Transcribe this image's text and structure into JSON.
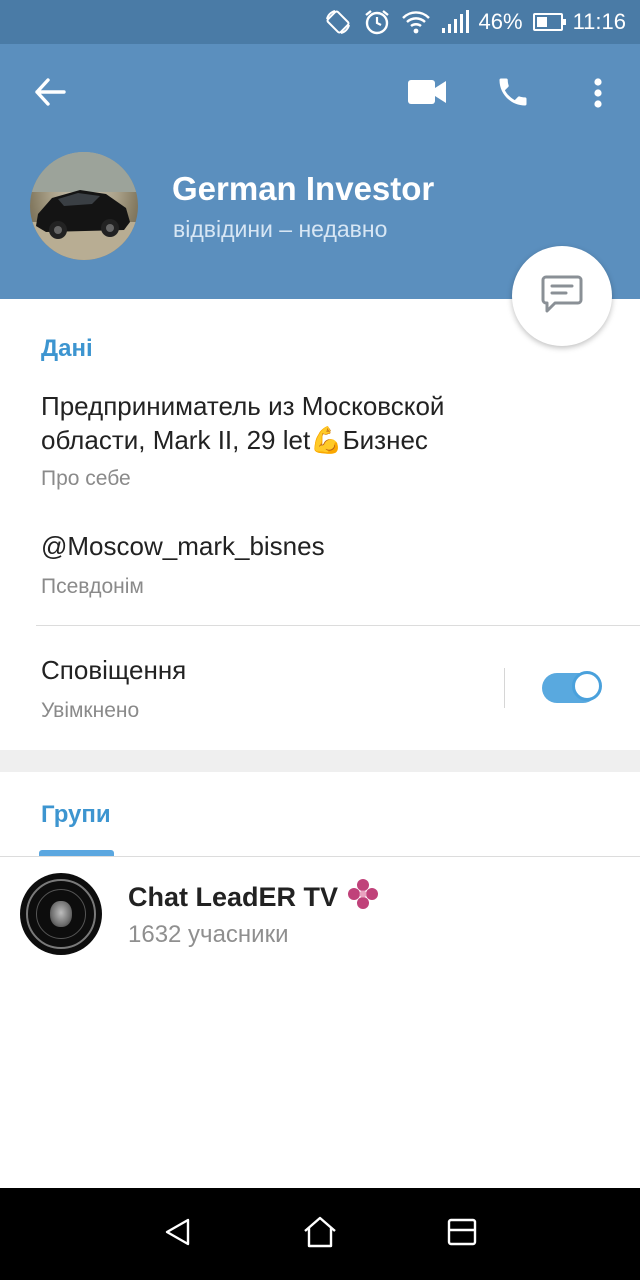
{
  "status_bar": {
    "battery_percent": "46%",
    "battery_level": 0.46,
    "time": "11:16",
    "icons": [
      "rotate-icon",
      "alarm-icon",
      "wifi-icon",
      "signal-icon",
      "battery-icon"
    ]
  },
  "header": {
    "icons": [
      "back-arrow-icon",
      "video-call-icon",
      "phone-icon",
      "more-vert-icon"
    ],
    "profile": {
      "name": "German Investor",
      "status": "відвідини – недавно"
    },
    "fab_icon": "message-icon"
  },
  "info": {
    "section_title": "Дані",
    "bio_line1": "Предприниматель из Московской",
    "bio_line2_text": "области, Mark II, 29 let",
    "bio_emoji": "💪",
    "bio_line2_end": "Бизнес",
    "bio_label": "Про себе",
    "username": "@Moscow_mark_bisnes",
    "username_label": "Псевдонім",
    "notifications_title": "Сповіщення",
    "notifications_state": "Увімкнено",
    "notifications_enabled": true
  },
  "groups": {
    "section_title": "Групи",
    "items": [
      {
        "name": "Chat LeadER TV",
        "emoji": "💠",
        "members": "1632 учасники"
      }
    ]
  },
  "nav_bar": {
    "icons": [
      "back-triangle-icon",
      "home-icon",
      "recents-icon"
    ]
  },
  "colors": {
    "header": "#5b8fbe",
    "status_bar": "#4a7ba6",
    "accent": "#3d95d0",
    "toggle": "#59a9df"
  }
}
